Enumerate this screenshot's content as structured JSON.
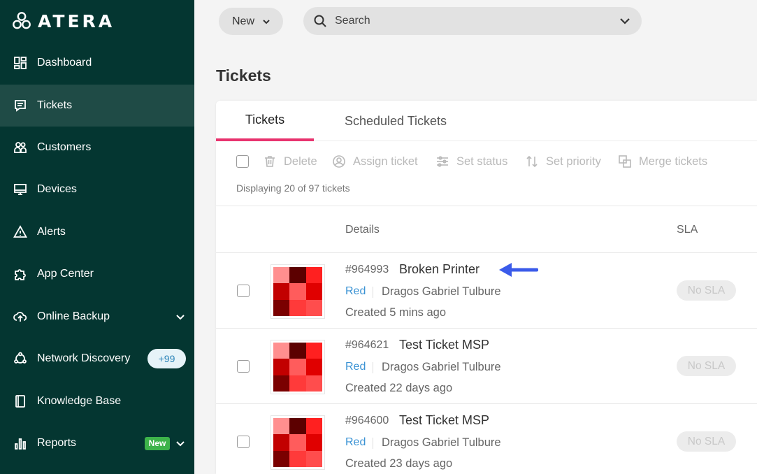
{
  "brand": {
    "logo_text": "ATERA"
  },
  "sidebar": {
    "items": [
      {
        "label": "Dashboard"
      },
      {
        "label": "Tickets"
      },
      {
        "label": "Customers"
      },
      {
        "label": "Devices"
      },
      {
        "label": "Alerts"
      },
      {
        "label": "App Center"
      },
      {
        "label": "Online Backup"
      },
      {
        "label": "Network Discovery",
        "badge": "+99"
      },
      {
        "label": "Knowledge Base"
      },
      {
        "label": "Reports",
        "badge": "New"
      }
    ]
  },
  "topbar": {
    "new_label": "New",
    "search_placeholder": "Search"
  },
  "page": {
    "title": "Tickets",
    "tabs": [
      {
        "label": "Tickets"
      },
      {
        "label": "Scheduled Tickets"
      }
    ],
    "toolbar": {
      "delete": "Delete",
      "assign": "Assign ticket",
      "status": "Set status",
      "priority": "Set priority",
      "merge": "Merge tickets"
    },
    "displaying": "Displaying 20 of 97 tickets",
    "columns": {
      "details": "Details",
      "sla": "SLA"
    }
  },
  "tickets": [
    {
      "number": "#964993",
      "title": "Broken Printer",
      "priority": "Red",
      "assignee": "Dragos Gabriel Tulbure",
      "created": "Created 5 mins ago",
      "sla": "No SLA"
    },
    {
      "number": "#964621",
      "title": "Test Ticket MSP",
      "priority": "Red",
      "assignee": "Dragos Gabriel Tulbure",
      "created": "Created 22 days ago",
      "sla": "No SLA"
    },
    {
      "number": "#964600",
      "title": "Test Ticket MSP",
      "priority": "Red",
      "assignee": "Dragos Gabriel Tulbure",
      "created": "Created 23 days ago",
      "sla": "No SLA"
    }
  ],
  "colors": {
    "sidebar_bg": "#043631",
    "sidebar_active": "#1f4b46",
    "tab_accent": "#e8336e",
    "link_blue": "#3b93d4",
    "annotation_arrow": "#3b5bea",
    "avatar_palette": [
      "#ff8f8f",
      "#5c0000",
      "#ff2020",
      "#c20000",
      "#ff5c5c",
      "#e00000",
      "#7a0000",
      "#ff3a3a",
      "#ff4d4d"
    ]
  }
}
